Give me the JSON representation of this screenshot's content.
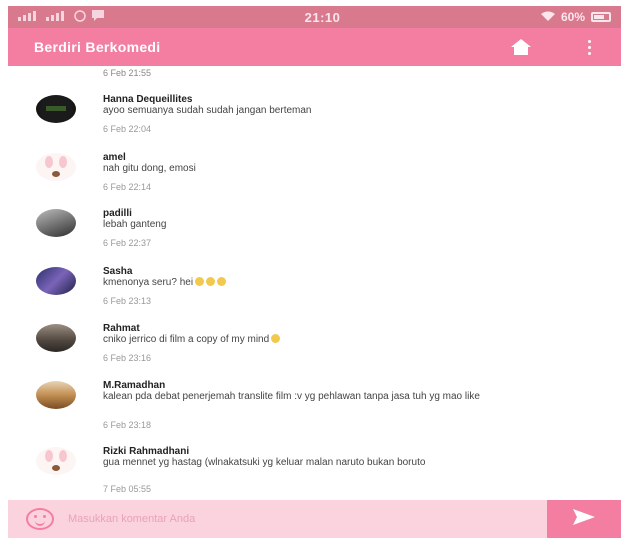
{
  "status_bar": {
    "time": "21:10",
    "battery": "60%",
    "left_icons": [
      "signal-icon",
      "signal-icon",
      "whatsapp-icon",
      "message-icon"
    ],
    "right_icons": [
      "wifi-icon",
      "battery-icon"
    ]
  },
  "app_bar": {
    "title": "Berdiri Berkomedi",
    "icons": [
      "home-icon",
      "more-vert-icon"
    ]
  },
  "top_timestamp": "6 Feb 21:55",
  "comments": [
    {
      "name": "Hanna Dequeillites",
      "text": "ayoo semuanya sudah sudah jangan berteman",
      "timestamp": "6 Feb 22:04",
      "avatar": "dark"
    },
    {
      "name": "amel",
      "text": "nah gitu dong, emosi",
      "timestamp": "6 Feb 22:14",
      "avatar": "cartoon"
    },
    {
      "name": "padilli",
      "text": "lebah ganteng",
      "timestamp": "6 Feb 22:37",
      "avatar": "photo-gray"
    },
    {
      "name": "Sasha",
      "text": "kmenonya seru? hei",
      "timestamp": "6 Feb 23:13",
      "avatar": "photo-purple"
    },
    {
      "name": "Rahmat",
      "text": "cniko jerrico di film a copy of my mind",
      "timestamp": "6 Feb 23:16",
      "avatar": "photo-brown"
    },
    {
      "name": "M.Ramadhan",
      "text": "kalean pda debat penerjemah translite film :v yg pehlawan tanpa jasa tuh yg mao like",
      "timestamp": "6 Feb 23:18",
      "avatar": "photo-warm"
    },
    {
      "name": "Rizki Rahmadhani",
      "text": "gua mennet yg hastag (wlnakatsuki yg keluar malan naruto bukan boruto",
      "timestamp": "7 Feb 05:55",
      "avatar": "cartoon"
    }
  ],
  "input": {
    "placeholder": "Masukkan komentar Anda",
    "value": ""
  },
  "colors": {
    "status_bar": "#d9798e",
    "app_bar": "#f47ea2",
    "input_bar": "#fbd3de",
    "send_button": "#f47ea2"
  }
}
